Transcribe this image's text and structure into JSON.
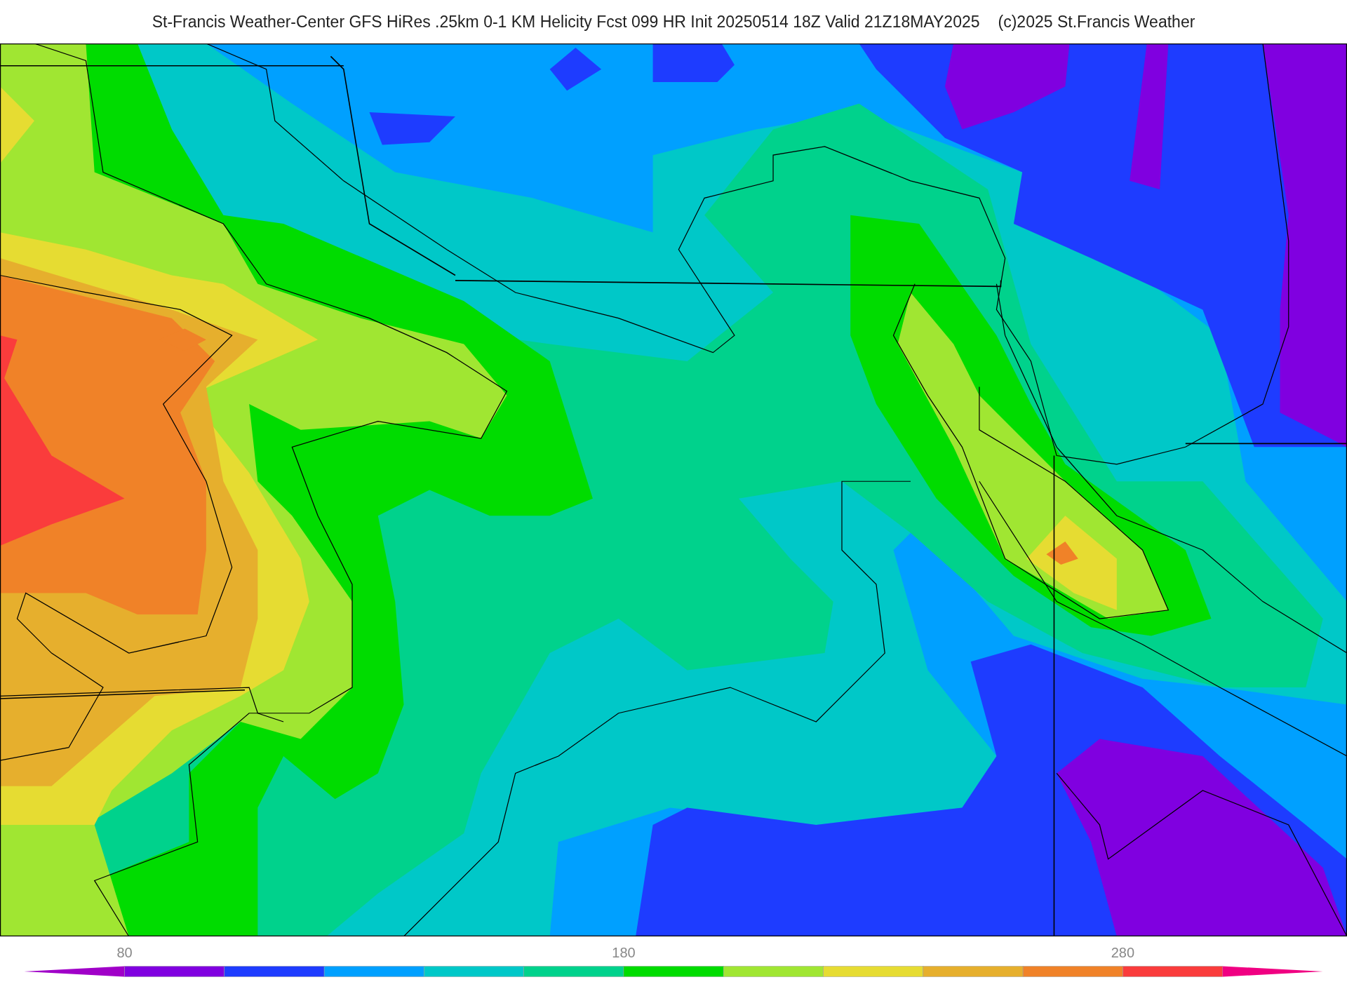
{
  "header": {
    "title": "St-Francis Weather-Center GFS HiRes .25km 0-1 KM Helicity Fcst 099 HR Init 20250514 18Z  Valid 21Z18MAY2025",
    "copyright": "(c)2025 St.Francis Weather"
  },
  "colorbar": {
    "ticks": [
      {
        "label": "80"
      },
      {
        "label": "180"
      },
      {
        "label": "280"
      }
    ],
    "bins": [
      {
        "kind": "extend-left",
        "color": "#a000c8"
      },
      {
        "kind": "box",
        "color": "#8000e0"
      },
      {
        "kind": "box",
        "color": "#1e3cff"
      },
      {
        "kind": "box",
        "color": "#00a0ff"
      },
      {
        "kind": "box",
        "color": "#00c8c8"
      },
      {
        "kind": "box",
        "color": "#00d28c"
      },
      {
        "kind": "box",
        "color": "#00dc00"
      },
      {
        "kind": "box",
        "color": "#a0e632"
      },
      {
        "kind": "box",
        "color": "#e6dc32"
      },
      {
        "kind": "box",
        "color": "#e6af2d"
      },
      {
        "kind": "box",
        "color": "#f08228"
      },
      {
        "kind": "box",
        "color": "#fa3c3c"
      },
      {
        "kind": "extend-right",
        "color": "#f00082"
      }
    ]
  }
}
